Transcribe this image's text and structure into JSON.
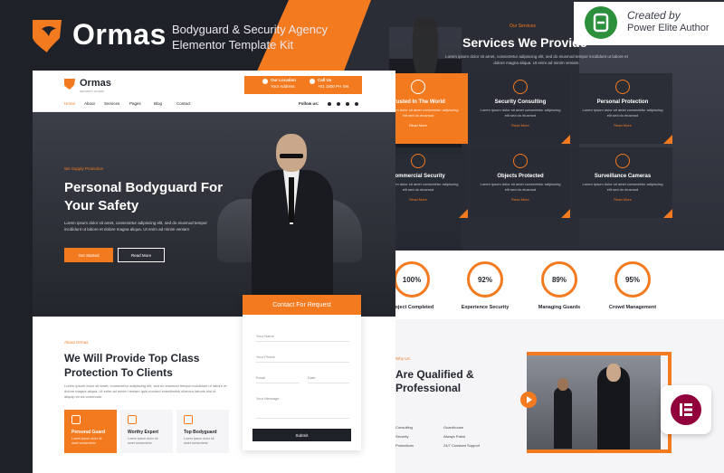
{
  "banner": {
    "brand": "Ormas",
    "kit_title_line1": "Bodyguard & Security Agency",
    "kit_title_line2": "Elementor Template Kit",
    "badge_created": "Created by",
    "badge_author": "Power Elite Author"
  },
  "site": {
    "logo": "Ormas",
    "logo_sub": "SECURITY GUARD",
    "our_location_label": "Our Location",
    "our_location_value": "Your Address",
    "call_us_label": "Call Us",
    "call_us_value": "+01 1800 PH Set",
    "nav": [
      "Home",
      "About",
      "Services",
      "Pages",
      "Blog",
      "Contact"
    ],
    "follow_label": "Follow us:",
    "hero": {
      "eyebrow": "We Supply Protection",
      "title": "Personal Bodyguard For Your Safety",
      "desc": "Lorem ipsum dolor sit amet, consectetur adipiscing elit, sed do eiusmod tempor incididunt ut labore et dolore magna aliqua. Ut enim ad minim veniam",
      "btn_primary": "Get Started",
      "btn_secondary": "Read More"
    },
    "contact": {
      "title": "Contact For Request",
      "fields": [
        "Your Name",
        "Your Phone",
        "Email",
        "Date",
        "Your Message"
      ],
      "submit": "Submit"
    },
    "about": {
      "eyebrow": "About Ormas",
      "title": "We Will Provide Top Class Protection To Clients",
      "desc": "Lorem ipsum dolor sit amet, consectetur adipiscing elit, sed do eiusmod tempor incididunt ut labore et dolore magna aliqua. Ut enim ad minim veniam quis nostrud exercitation ullamco laboris nisi ut aliquip ex ea commodo.",
      "features": [
        {
          "title": "Personal Guard",
          "desc": "Lorem ipsum dolor sit amet consectetur"
        },
        {
          "title": "Worthy Expert",
          "desc": "Lorem ipsum dolor sit amet consectetur"
        },
        {
          "title": "Top Bodyguard",
          "desc": "Lorem ipsum dolor sit amet consectetur"
        }
      ]
    }
  },
  "services": {
    "eyebrow": "Our Services",
    "title": "Services We Provide",
    "desc": "Lorem ipsum dolor sit amet, consectetur adipiscing elit, sed do eiusmod tempor incididunt ut labore et dolore magna aliqua. Ut enim ad minim veniam.",
    "cards": [
      {
        "title": "Trusted In The World",
        "desc": "Lorem ipsum dolor sit amet consectetur adipiscing elit sed do eiusmod",
        "link": "Read More",
        "icon": "globe-icon"
      },
      {
        "title": "Security Consulting",
        "desc": "Lorem ipsum dolor sit amet consectetur adipiscing elit sed do eiusmod",
        "link": "Read More",
        "icon": "people-icon"
      },
      {
        "title": "Personal Protection",
        "desc": "Lorem ipsum dolor sit amet consectetur adipiscing elit sed do eiusmod",
        "link": "Read More",
        "icon": "person-badge-icon"
      },
      {
        "title": "Commercial Security",
        "desc": "Lorem ipsum dolor sit amet consectetur adipiscing elit sed do eiusmod",
        "link": "Read More",
        "icon": "shield-icon"
      },
      {
        "title": "Objects Protected",
        "desc": "Lorem ipsum dolor sit amet consectetur adipiscing elit sed do eiusmod",
        "link": "Read More",
        "icon": "lock-icon"
      },
      {
        "title": "Surveillance Cameras",
        "desc": "Lorem ipsum dolor sit amet consectetur adipiscing elit sed do eiusmod",
        "link": "Read More",
        "icon": "camera-icon"
      }
    ]
  },
  "stats": [
    {
      "value": "100%",
      "label": "Project Completed"
    },
    {
      "value": "92%",
      "label": "Experience Security"
    },
    {
      "value": "89%",
      "label": "Managing Guards"
    },
    {
      "value": "95%",
      "label": "Crowd Management"
    }
  ],
  "qualified": {
    "eyebrow": "Why Us",
    "title_line1": "Are Qualified &",
    "title_line2": "Professional",
    "items": [
      "Consulting",
      "Security",
      "Protections",
      "Guardhouse",
      "Always Patrol",
      "24/7 Constant Support"
    ]
  },
  "colors": {
    "accent": "#f47a20",
    "dark": "#1f2129"
  }
}
